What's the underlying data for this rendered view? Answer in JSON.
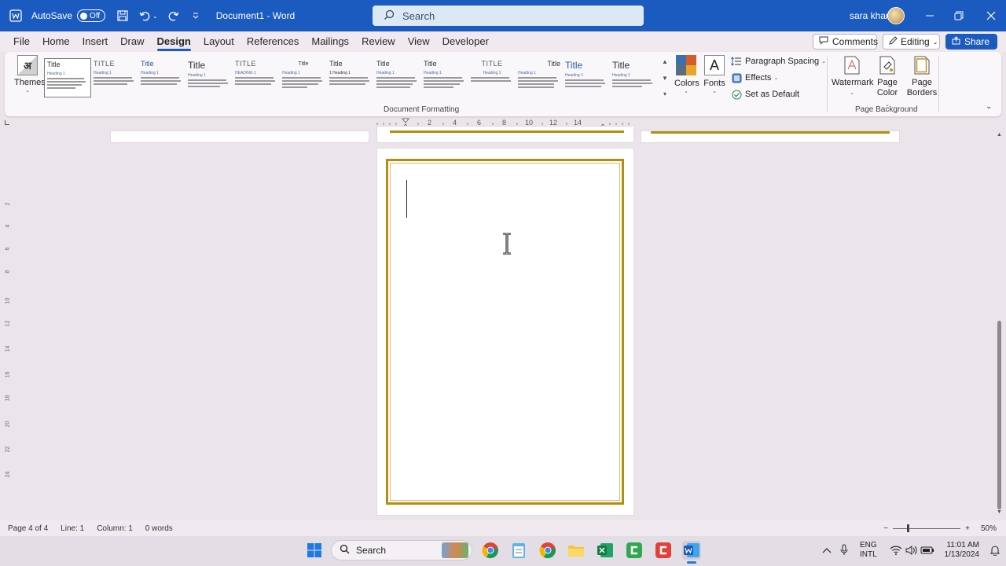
{
  "titlebar": {
    "autosave_label": "AutoSave",
    "autosave_state": "Off",
    "document_title": "Document1  -  Word",
    "search_placeholder": "Search",
    "user_name": "sara khan"
  },
  "menu": {
    "items": [
      "File",
      "Home",
      "Insert",
      "Draw",
      "Design",
      "Layout",
      "References",
      "Mailings",
      "Review",
      "View",
      "Developer"
    ],
    "active": "Design",
    "comments_label": "Comments",
    "editing_label": "Editing",
    "share_label": "Share"
  },
  "ribbon": {
    "themes_label": "Themes",
    "style_gallery": [
      {
        "title": "Title",
        "heading": "Heading 1"
      },
      {
        "title": "TITLE",
        "heading": "Heading 1"
      },
      {
        "title": "Title",
        "heading": "Heading 1"
      },
      {
        "title": "Title",
        "heading": "Heading 1"
      },
      {
        "title": "TITLE",
        "heading": "HEADING 1"
      },
      {
        "title": "Title",
        "heading": "Heading 1"
      },
      {
        "title": "Title",
        "heading": "1  Heading 1"
      },
      {
        "title": "Title",
        "heading": "Heading 1"
      },
      {
        "title": "Title",
        "heading": "Heading 1"
      },
      {
        "title": "TITLE",
        "heading": "Heading 1"
      },
      {
        "title": "Title",
        "heading": "Heading 1"
      },
      {
        "title": "Title",
        "heading": "Heading 1"
      },
      {
        "title": "Title",
        "heading": "Heading 1"
      }
    ],
    "document_formatting_label": "Document Formatting",
    "colors_label": "Colors",
    "fonts_label": "Fonts",
    "fonts_glyph": "A",
    "paragraph_spacing_label": "Paragraph Spacing",
    "effects_label": "Effects",
    "set_default_label": "Set as Default",
    "watermark_label": "Watermark",
    "page_color_label_1": "Page",
    "page_color_label_2": "Color",
    "page_borders_label_1": "Page",
    "page_borders_label_2": "Borders",
    "page_background_label": "Page Background"
  },
  "ruler": {
    "h_ticks": [
      "2",
      "4",
      "6",
      "8",
      "10",
      "12",
      "14"
    ],
    "v_ticks": [
      "2",
      "4",
      "6",
      "8",
      "10",
      "12",
      "14",
      "16",
      "18",
      "20",
      "22",
      "24"
    ]
  },
  "statusbar": {
    "page": "Page 4 of 4",
    "line": "Line: 1",
    "column": "Column: 1",
    "words": "0 words",
    "zoom": "50%",
    "zoom_level": 0.5
  },
  "taskbar": {
    "search_label": "Search",
    "lang_1": "ENG",
    "lang_2": "INTL",
    "time": "11:01 AM",
    "date": "1/13/2024"
  },
  "colors": {
    "titlebar": "#1b5bbf",
    "page_border": "#b38e0f",
    "accent": "#1b5bbf"
  }
}
